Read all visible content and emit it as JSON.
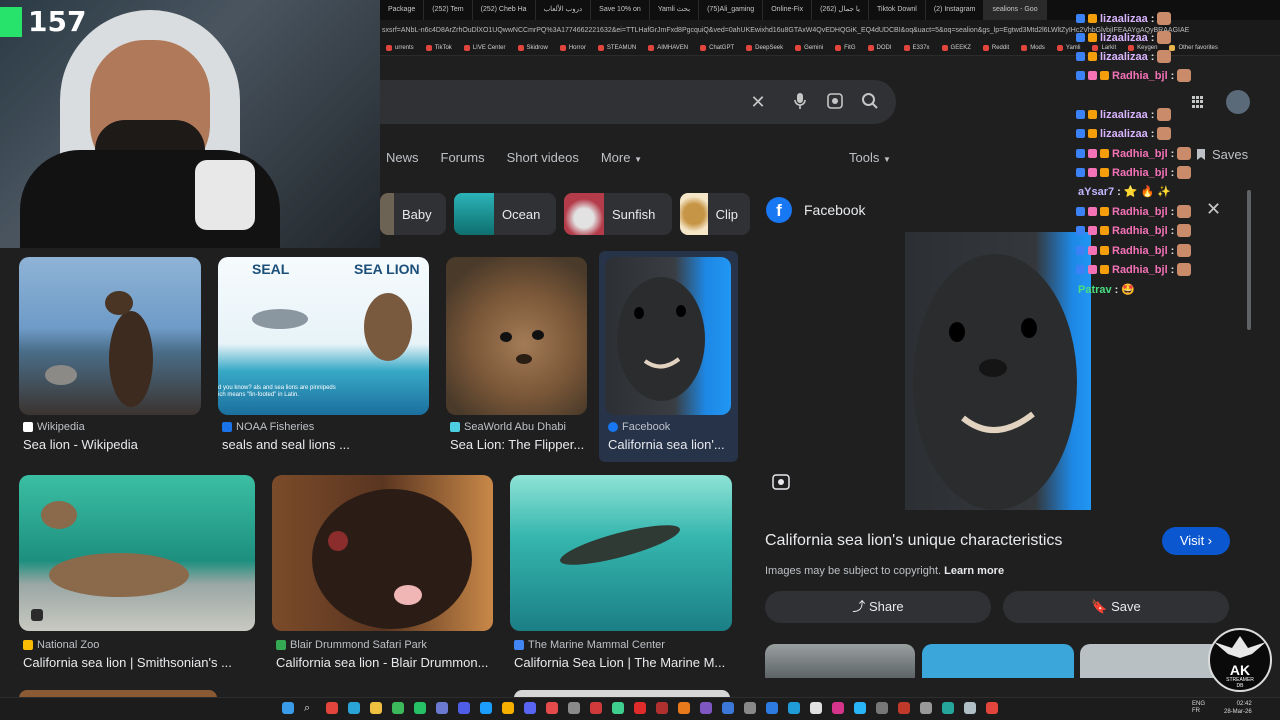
{
  "browser": {
    "tabs": [
      "Package",
      "(252) Tem",
      "(252) Cheb Ha",
      "دروب الألعاب",
      "Save 10% on",
      "Yamli بحث",
      "(75)Ali_gaming",
      "Online-Fix",
      "(262) يا جمال",
      "Tiktok Downl",
      "(2) Instagram",
      "sealions - Goo"
    ],
    "url": "sxsrf=ANbL-n6c4D8ArZrhOuDlXO1UQwwNCCmrPQ%3A1774662221632&ei=TTLHafGrJmFxd8PgcquiQ&ved=0ahUKEwixhd16u8GTAxW4QvEDHQGiK_EQ4dUDCBI&oq&uact=5&oq=sealion&gs_lp=Egtwd3Mtd2l6LWltZyIHc2VhbGlvbjIFEAAYgAQyBRAAGIAE",
    "bookmarks": [
      "urrents",
      "TikTok",
      "LIVE Center",
      "Skidrow",
      "Horror",
      "STEAMUN",
      "AIMHAVEN",
      "ChatGPT",
      "DeepSeek",
      "Gemini",
      "FitG",
      "DODI",
      "E337x",
      "GEEKZ",
      "Reddit",
      "Mods",
      "Yamli",
      "Larkit",
      "Keygen",
      "Other favorites"
    ]
  },
  "search": {
    "nav": [
      "News",
      "Forums",
      "Short videos",
      "More"
    ],
    "tools": "Tools",
    "chips": [
      "Baby",
      "Ocean",
      "Sunfish",
      "Clip"
    ],
    "saves": "Saves"
  },
  "stream": {
    "viewers": "157"
  },
  "results": [
    {
      "source": "Wikipedia",
      "title": "Sea lion - Wikipedia",
      "color": "#ffffff"
    },
    {
      "source": "NOAA Fisheries",
      "title": "seals and seal lions ...",
      "color": "#1a73e8"
    },
    {
      "source": "SeaWorld Abu Dhabi",
      "title": "Sea Lion: The Flipper...",
      "color": "#4dd0e1"
    },
    {
      "source": "Facebook",
      "title": "California sea lion'...",
      "color": "#1877f2"
    },
    {
      "source": "National Zoo",
      "title": "California sea lion | Smithsonian's ...",
      "color": "#fbbc04"
    },
    {
      "source": "Blair Drummond Safari Park",
      "title": "California sea lion - Blair Drummon...",
      "color": "#34a853"
    },
    {
      "source": "The Marine Mammal Center",
      "title": "California Sea Lion | The Marine M...",
      "color": "#4285f4"
    }
  ],
  "infographic": {
    "left": "SEAL",
    "right": "SEA LION",
    "caption": "d you know? als and sea lions are pinnipeds ich means \"fin-footed\" in Latin."
  },
  "panel": {
    "source": "Facebook",
    "title": "California sea lion's unique characteristics",
    "visit": "Visit",
    "copyright": "Images may be subject to copyright.",
    "learn_more": "Learn more",
    "share": "Share",
    "save": "Save"
  },
  "chat": [
    {
      "user": "lizaalizaa",
      "color": "#d8b4fe"
    },
    {
      "user": "lizaalizaa",
      "color": "#d8b4fe"
    },
    {
      "user": "lizaalizaa",
      "color": "#d8b4fe"
    },
    {
      "user": "Radhia_bjl",
      "color": "#f472b6"
    },
    {
      "user": "lizaalizaa",
      "color": "#d8b4fe"
    },
    {
      "user": "lizaalizaa",
      "color": "#d8b4fe"
    },
    {
      "user": "Radhia_bjl",
      "color": "#f472b6"
    },
    {
      "user": "Radhia_bjl",
      "color": "#f472b6"
    },
    {
      "user": "aYsar7",
      "color": "#c4b5fd",
      "message": "⭐ 🔥 ✨"
    },
    {
      "user": "Radhia_bjl",
      "color": "#f472b6"
    },
    {
      "user": "Radhia_bjl",
      "color": "#f472b6"
    },
    {
      "user": "Radhia_bjl",
      "color": "#f472b6"
    },
    {
      "user": "Radhia_bjl",
      "color": "#f472b6"
    },
    {
      "user": "Patrav",
      "color": "#4ade80",
      "message": "🤩"
    }
  ],
  "taskbar": {
    "time": "02:42",
    "date": "28-Mar-26",
    "lang1": "ENG",
    "lang2": "FR"
  },
  "logo": {
    "line1": "AK",
    "line2": "STREAMER",
    "line3": "DB"
  }
}
